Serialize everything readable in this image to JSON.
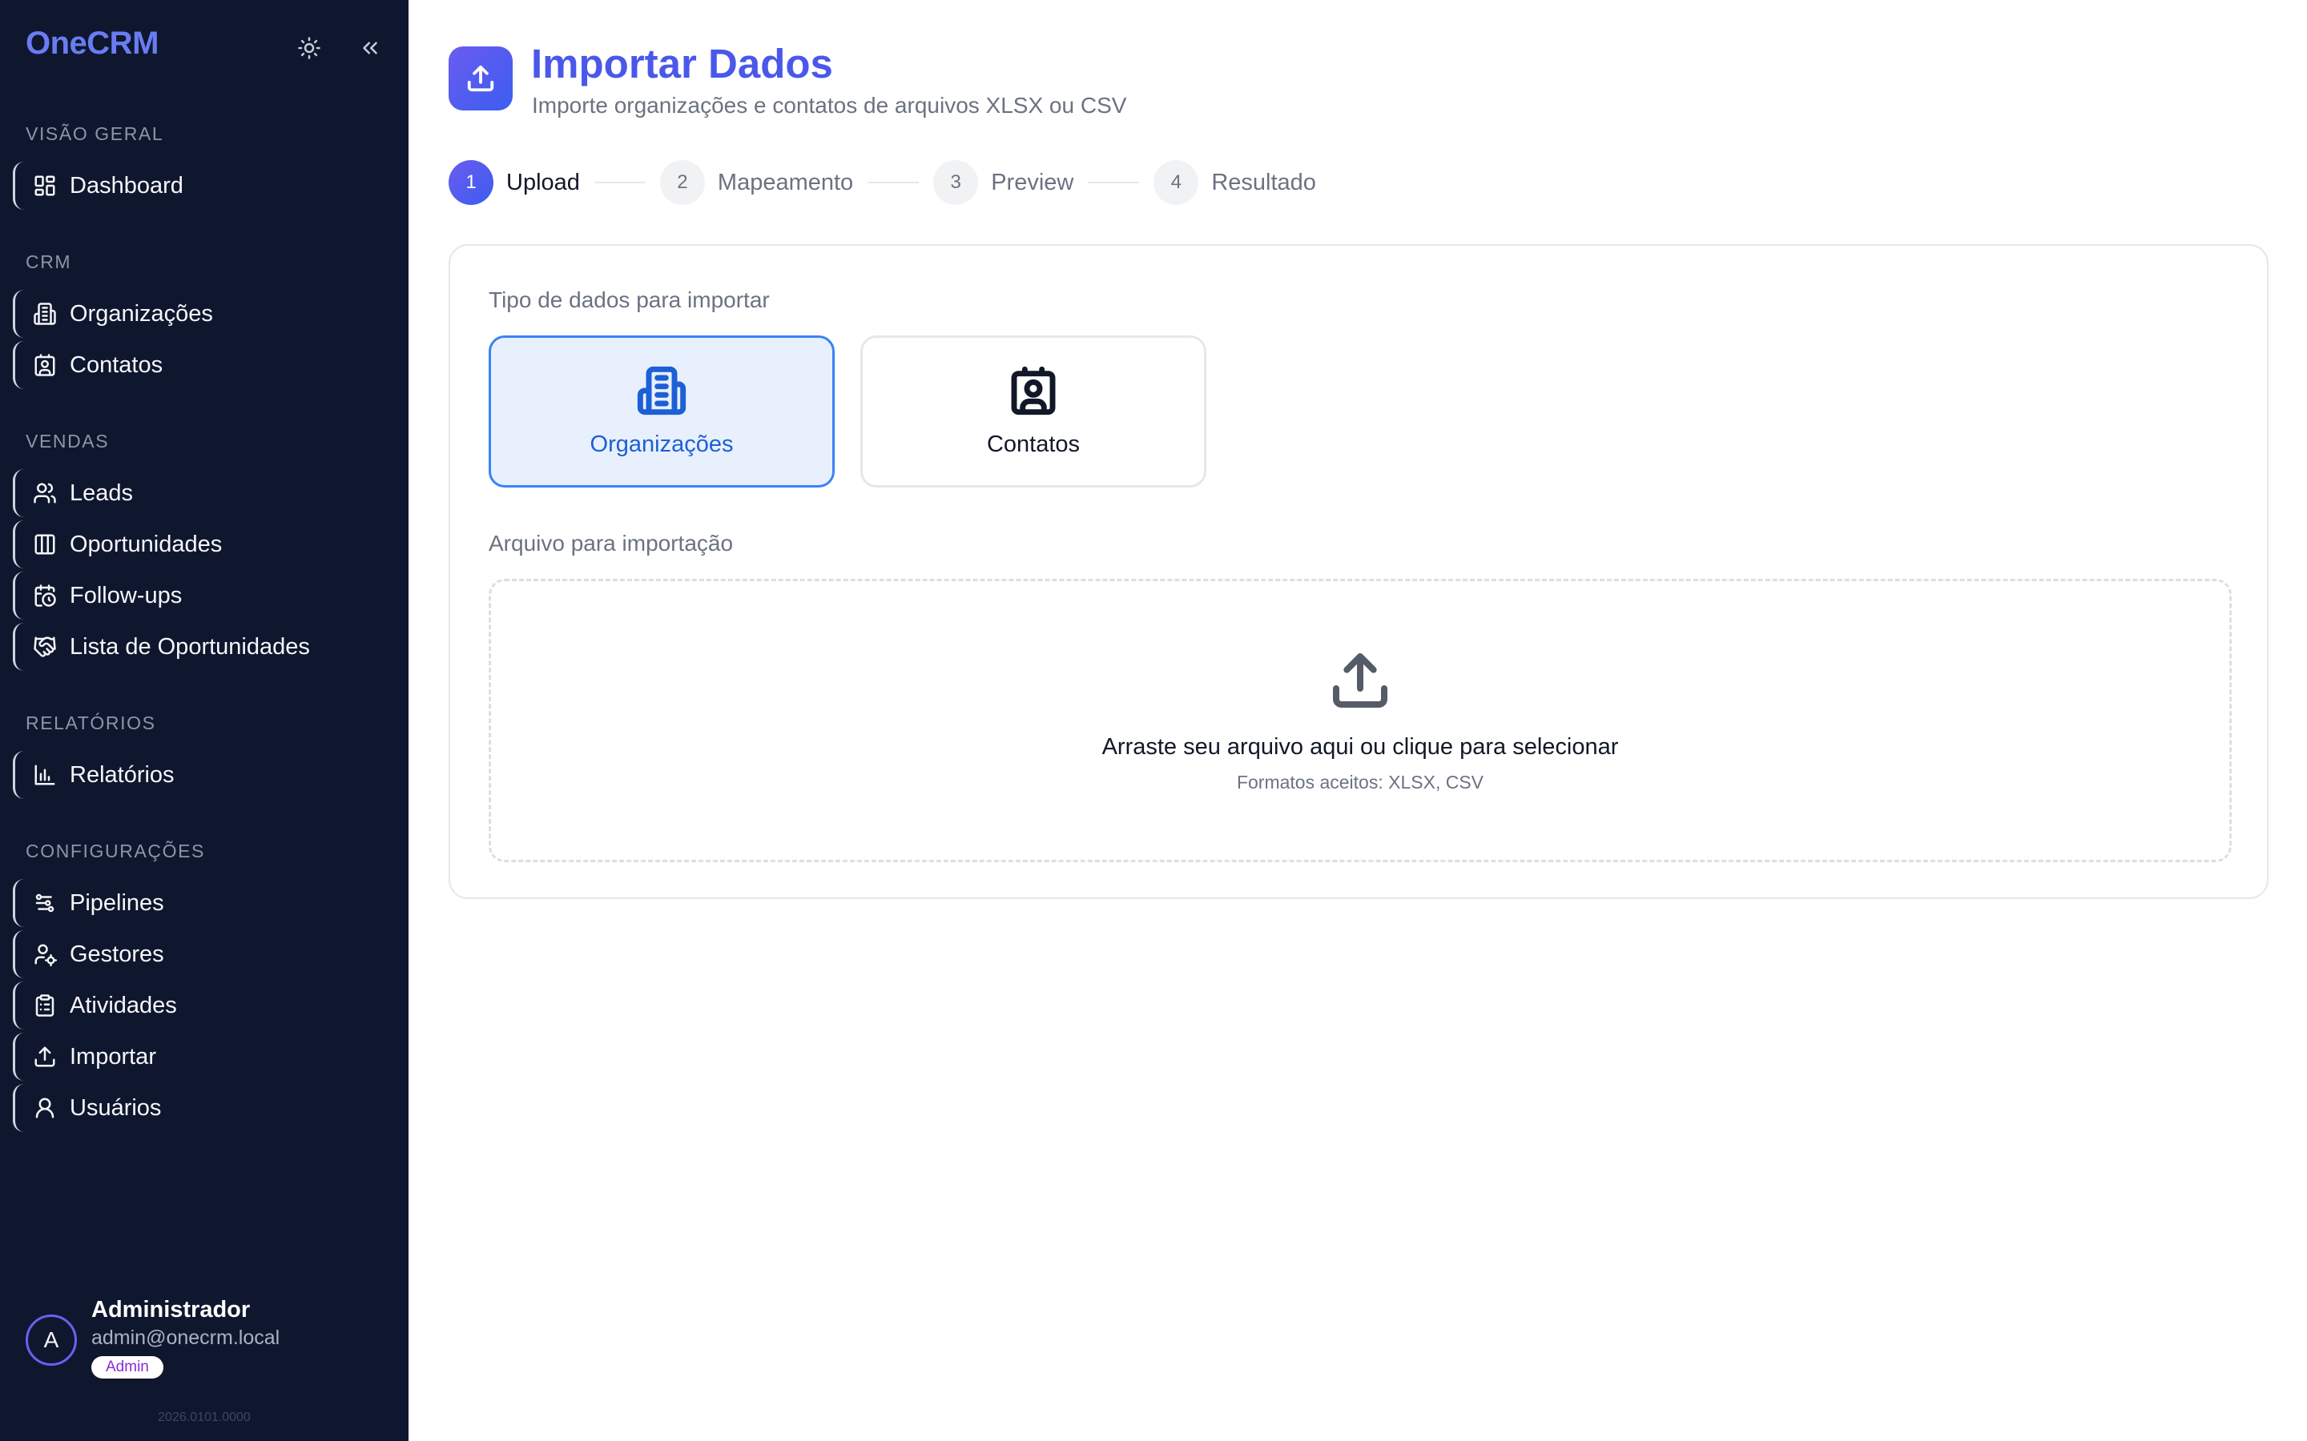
{
  "app": {
    "name": "OneCRM"
  },
  "sidebar": {
    "sections": [
      {
        "label": "VISÃO GERAL",
        "items": [
          {
            "label": "Dashboard",
            "icon": "dashboard-icon"
          }
        ]
      },
      {
        "label": "CRM",
        "items": [
          {
            "label": "Organizações",
            "icon": "building-icon"
          },
          {
            "label": "Contatos",
            "icon": "contact-icon"
          }
        ]
      },
      {
        "label": "VENDAS",
        "items": [
          {
            "label": "Leads",
            "icon": "users-icon"
          },
          {
            "label": "Oportunidades",
            "icon": "kanban-icon"
          },
          {
            "label": "Follow-ups",
            "icon": "calendar-clock-icon"
          },
          {
            "label": "Lista de Oportunidades",
            "icon": "handshake-icon"
          }
        ]
      },
      {
        "label": "RELATÓRIOS",
        "items": [
          {
            "label": "Relatórios",
            "icon": "bar-chart-icon"
          }
        ]
      },
      {
        "label": "CONFIGURAÇÕES",
        "items": [
          {
            "label": "Pipelines",
            "icon": "pipeline-icon"
          },
          {
            "label": "Gestores",
            "icon": "user-cog-icon"
          },
          {
            "label": "Atividades",
            "icon": "clipboard-icon"
          },
          {
            "label": "Importar",
            "icon": "upload-icon"
          },
          {
            "label": "Usuários",
            "icon": "user-icon"
          }
        ]
      }
    ],
    "tools": {
      "theme_icon": "sun-icon",
      "collapse_icon": "chevrons-left-icon"
    }
  },
  "user": {
    "initial": "A",
    "name": "Administrador",
    "email": "admin@onecrm.local",
    "role": "Admin"
  },
  "version": "2026.0101.0000",
  "page": {
    "title": "Importar Dados",
    "subtitle": "Importe organizações e contatos de arquivos XLSX ou CSV",
    "icon": "upload-icon"
  },
  "stepper": [
    {
      "num": "1",
      "label": "Upload",
      "active": true
    },
    {
      "num": "2",
      "label": "Mapeamento",
      "active": false
    },
    {
      "num": "3",
      "label": "Preview",
      "active": false
    },
    {
      "num": "4",
      "label": "Resultado",
      "active": false
    }
  ],
  "form": {
    "type_label": "Tipo de dados para importar",
    "types": [
      {
        "label": "Organizações",
        "icon": "building-icon",
        "selected": true
      },
      {
        "label": "Contatos",
        "icon": "contact-icon",
        "selected": false
      }
    ],
    "file_label": "Arquivo para importação",
    "dropzone": {
      "icon": "upload-icon",
      "text": "Arraste seu arquivo aqui ou clique para selecionar",
      "formats": "Formatos aceitos: XLSX, CSV"
    }
  },
  "colors": {
    "sidebar_bg": "#0f172e",
    "brand": "#6a7cf2",
    "title": "#4a58ea",
    "selected_border": "#3b82f6",
    "selected_bg": "#e8f0fd"
  }
}
